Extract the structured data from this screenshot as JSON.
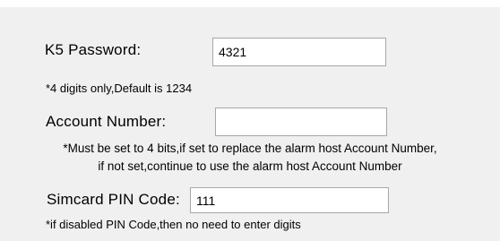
{
  "form": {
    "k5_password": {
      "label": "K5 Password:",
      "value": "4321",
      "hint": "*4 digits only,Default is 1234"
    },
    "account_number": {
      "label": "Account Number:",
      "value": "",
      "hint_line1": "*Must be set to 4 bits,if set to replace the alarm host Account Number,",
      "hint_line2": "if not set,continue to use the alarm host Account Number"
    },
    "simcard_pin": {
      "label": "Simcard PIN Code:",
      "value": "111",
      "hint": "*if disabled PIN Code,then no need to enter digits"
    }
  }
}
